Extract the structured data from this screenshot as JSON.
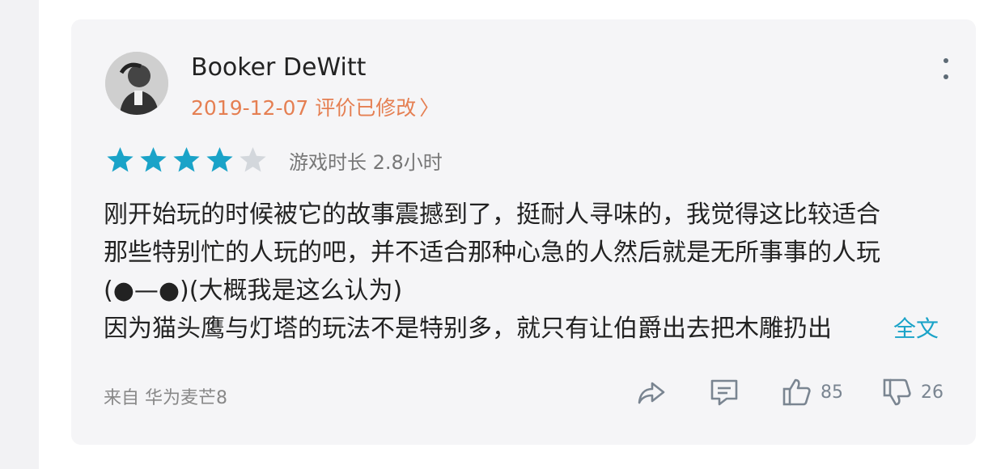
{
  "review": {
    "author": "Booker DeWitt",
    "meta_text": "2019-12-07 评价已修改",
    "meta_chevron": "〉",
    "rating": 4,
    "rating_max": 5,
    "playtime_text": "游戏时长 2.8小时",
    "lines": [
      "刚开始玩的时候被它的故事震撼到了，挺耐人寻味的，我觉得这比较适合",
      "那些特别忙的人玩的吧，并不适合那种心急的人然后就是无所事事的人玩",
      "(●—●)(大概我是这么认为)",
      "因为猫头鹰与灯塔的玩法不是特别多，就只有让伯爵出去把木雕扔出"
    ],
    "full_text_label": "全文",
    "source_text": "来自 华为麦芒8",
    "likes": "85",
    "dislikes": "26"
  },
  "colors": {
    "accent_orange": "#e57f52",
    "star_filled": "#1aa3c8",
    "star_empty": "#d3d7dc",
    "link": "#1aa3c8"
  },
  "icons": [
    "more-vertical-icon",
    "star-icon",
    "share-icon",
    "comment-icon",
    "thumbs-up-icon",
    "thumbs-down-icon"
  ]
}
